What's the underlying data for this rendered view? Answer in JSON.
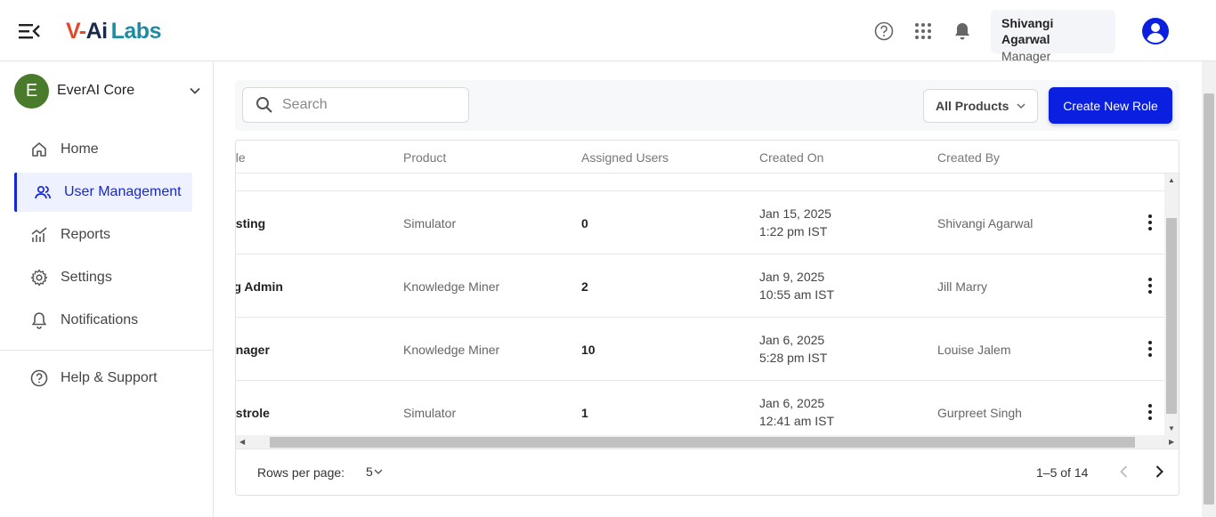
{
  "header": {
    "logo": {
      "v": "V-",
      "ai": "Ai",
      "labs": "Labs"
    },
    "user_name": "Shivangi Agarwal",
    "user_role": "Manager"
  },
  "sidebar": {
    "org_initial": "E",
    "org_name": "EverAI Core",
    "items": [
      {
        "label": "Home",
        "icon": "home-icon"
      },
      {
        "label": "User Management",
        "icon": "users-icon",
        "active": true
      },
      {
        "label": "Reports",
        "icon": "chart-icon"
      },
      {
        "label": "Settings",
        "icon": "gear-icon"
      },
      {
        "label": "Notifications",
        "icon": "bell-icon"
      }
    ],
    "help_label": "Help & Support"
  },
  "toolbar": {
    "search_placeholder": "Search",
    "filter_label": "All Products",
    "create_label": "Create New Role"
  },
  "table": {
    "columns": [
      "ole",
      "Product",
      "Assigned Users",
      "Created On",
      "Created By"
    ],
    "rows": [
      {
        "role": "esting",
        "product": "Simulator",
        "users": "0",
        "date": "Jan 15, 2025",
        "time": "1:22 pm IST",
        "by": "Shivangi Agarwal"
      },
      {
        "role": "rg Admin",
        "product": "Knowledge Miner",
        "users": "2",
        "date": "Jan 9, 2025",
        "time": "10:55 am IST",
        "by": "Jill Marry"
      },
      {
        "role": "anager",
        "product": "Knowledge Miner",
        "users": "10",
        "date": "Jan 6, 2025",
        "time": "5:28 pm IST",
        "by": "Louise Jalem"
      },
      {
        "role": "estrole",
        "product": "Simulator",
        "users": "1",
        "date": "Jan 6, 2025",
        "time": "12:41 am IST",
        "by": "Gurpreet Singh"
      }
    ]
  },
  "pagination": {
    "rows_per_page_label": "Rows per page:",
    "rows_per_page": "5",
    "range": "1–5 of 14"
  },
  "colors": {
    "primary": "#0a1fe0",
    "active_nav": "#1528d8",
    "org_avatar": "#4a7a2c"
  }
}
